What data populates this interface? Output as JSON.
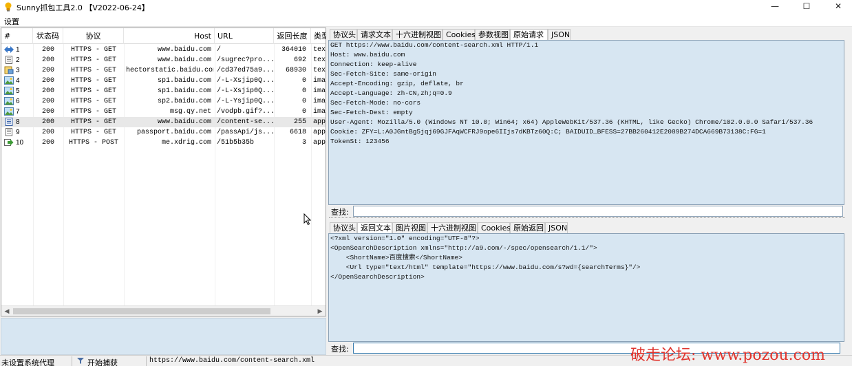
{
  "window": {
    "title": "Sunny抓包工具2.0 【V2022-06-24】",
    "controls": {
      "minimize": "—",
      "maximize": "☐",
      "close": "✕"
    }
  },
  "menu": {
    "settings": "设置"
  },
  "grid": {
    "columns": [
      "#",
      "状态码",
      "协议",
      "Host",
      "URL",
      "返回长度",
      "类型"
    ],
    "rows": [
      {
        "icon": "arrows-icon",
        "idx": "1",
        "status": "200",
        "proto": "HTTPS - GET",
        "host": "www.baidu.com",
        "url": "/",
        "len": "364010",
        "type": "tex..."
      },
      {
        "icon": "document-icon",
        "idx": "2",
        "status": "200",
        "proto": "HTTPS - GET",
        "host": "www.baidu.com",
        "url": "/sugrec?pro...",
        "len": "692",
        "type": "tex..."
      },
      {
        "icon": "script-icon",
        "idx": "3",
        "status": "200",
        "proto": "HTTPS - GET",
        "host": "hectorstatic.baidu.com",
        "url": "/cd37ed75a9...",
        "len": "68930",
        "type": "tex..."
      },
      {
        "icon": "image-icon",
        "idx": "4",
        "status": "200",
        "proto": "HTTPS - GET",
        "host": "sp1.baidu.com",
        "url": "/-L-Xsjip0Q...",
        "len": "0",
        "type": "ima..."
      },
      {
        "icon": "image-icon",
        "idx": "5",
        "status": "200",
        "proto": "HTTPS - GET",
        "host": "sp1.baidu.com",
        "url": "/-L-Xsjip0Q...",
        "len": "0",
        "type": "ima..."
      },
      {
        "icon": "image-icon",
        "idx": "6",
        "status": "200",
        "proto": "HTTPS - GET",
        "host": "sp2.baidu.com",
        "url": "/-L-Ysjip0Q...",
        "len": "0",
        "type": "ima..."
      },
      {
        "icon": "image-icon",
        "idx": "7",
        "status": "200",
        "proto": "HTTPS - GET",
        "host": "msg.qy.net",
        "url": "/vodpb.gif?...",
        "len": "0",
        "type": "ima..."
      },
      {
        "icon": "json-icon",
        "idx": "8",
        "status": "200",
        "proto": "HTTPS - GET",
        "host": "www.baidu.com",
        "url": "/content-se...",
        "len": "255",
        "type": "app..."
      },
      {
        "icon": "document-icon",
        "idx": "9",
        "status": "200",
        "proto": "HTTPS - GET",
        "host": "passport.baidu.com",
        "url": "/passApi/js...",
        "len": "6618",
        "type": "app..."
      },
      {
        "icon": "post-arrow-icon",
        "idx": "10",
        "status": "200",
        "proto": "HTTPS - POST",
        "host": "me.xdrig.com",
        "url": "/51b5b35b",
        "len": "3",
        "type": "app..."
      }
    ]
  },
  "request_panel": {
    "tabs": [
      "协议头",
      "请求文本",
      "十六进制视图",
      "Cookies",
      "参数视图",
      "原始请求",
      "JSON"
    ],
    "active_tab": "原始请求",
    "lines": [
      "GET https://www.baidu.com/content-search.xml HTTP/1.1",
      "Host: www.baidu.com",
      "Connection: keep-alive",
      "Sec-Fetch-Site: same-origin",
      "Accept-Encoding: gzip, deflate, br",
      "Accept-Language: zh-CN,zh;q=0.9",
      "Sec-Fetch-Mode: no-cors",
      "Sec-Fetch-Dest: empty",
      "User-Agent: Mozilla/5.0 (Windows NT 10.0; Win64; x64) AppleWebKit/537.36 (KHTML, like Gecko) Chrome/102.0.0.0 Safari/537.36",
      "Cookie: ZFY=L:A0JGntBg5jqj69GJFAqWCFRJ9ope6IIjs7dKBTz60Q:C; BAIDUID_BFESS=27BB260412E2089B274DCA669B73138C:FG=1",
      "TokenSt: 123456"
    ],
    "find_label": "查找:"
  },
  "response_panel": {
    "tabs": [
      "协议头",
      "返回文本",
      "图片视图",
      "十六进制视图",
      "Cookies",
      "原始返回",
      "JSON"
    ],
    "active_tab": "返回文本",
    "lines": [
      "<?xml version=\"1.0\" encoding=\"UTF-8\"?>",
      "<OpenSearchDescription xmlns=\"http://a9.com/-/spec/opensearch/1.1/\">",
      "    <ShortName>百度搜索</ShortName>",
      "    <Url type=\"text/html\" template=\"https://www.baidu.com/s?wd={searchTerms}\"/>",
      "</OpenSearchDescription>"
    ],
    "find_label": "查找:"
  },
  "statusbar": {
    "proxy": "未设置系统代理",
    "capture": "开始捕获",
    "url": "https://www.baidu.com/content-search.xml"
  },
  "watermark": "破走论坛: www.pozou.com",
  "colors": {
    "pane_bg": "#d7e6f2",
    "watermark": "#e0352e"
  }
}
